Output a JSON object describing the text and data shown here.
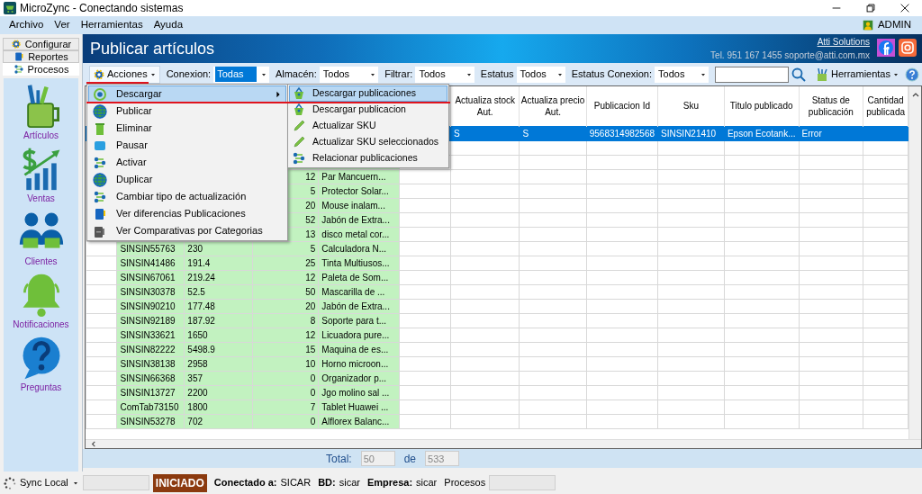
{
  "window": {
    "title": "MicroZync - Conectando sistemas"
  },
  "menu_bar": {
    "items": [
      "Archivo",
      "Ver",
      "Herramientas",
      "Ayuda"
    ],
    "user": "ADMIN"
  },
  "sidebar": {
    "tabs": [
      {
        "label": "Configurar",
        "selected": false
      },
      {
        "label": "Reportes",
        "selected": false
      },
      {
        "label": "Procesos",
        "selected": true
      }
    ],
    "items": [
      {
        "label": "Artículos"
      },
      {
        "label": "Ventas"
      },
      {
        "label": "Clientes"
      },
      {
        "label": "Notificaciones"
      },
      {
        "label": "Preguntas"
      }
    ]
  },
  "header": {
    "title": "Publicar artículos",
    "company": "Atti Solutions",
    "contact": "Tel. 951 167 1455  soporte@atti.com.mx"
  },
  "toolbar": {
    "actions": "Acciones",
    "filters": [
      {
        "label": "Conexion:",
        "value": "Todas",
        "text_selected": true
      },
      {
        "label": "Almacén:",
        "value": "Todos",
        "text_selected": false
      },
      {
        "label": "Filtrar:",
        "value": "Todos",
        "text_selected": false
      },
      {
        "label": "Estatus",
        "value": "Todos",
        "text_selected": false
      },
      {
        "label": "Estatus Conexion:",
        "value": "Todos",
        "text_selected": false
      }
    ],
    "tools": "Herramientas"
  },
  "actions_menu": {
    "items": [
      {
        "label": "Descargar",
        "selected": true,
        "has_submenu": true
      },
      {
        "label": "Publicar",
        "selected": false,
        "has_submenu": false
      },
      {
        "label": "Eliminar",
        "selected": false,
        "has_submenu": false
      },
      {
        "label": "Pausar",
        "selected": false,
        "has_submenu": false
      },
      {
        "label": "Activar",
        "selected": false,
        "has_submenu": false
      },
      {
        "label": "Duplicar",
        "selected": false,
        "has_submenu": false
      },
      {
        "label": "Cambiar tipo de actualización",
        "selected": false,
        "has_submenu": false
      },
      {
        "label": "Ver diferencias Publicaciones",
        "selected": false,
        "has_submenu": false
      },
      {
        "label": "Ver Comparativas por Categorias",
        "selected": false,
        "has_submenu": false
      }
    ]
  },
  "submenu": {
    "items": [
      {
        "label": "Descargar publicaciones",
        "selected": true
      },
      {
        "label": "Descargar publicacion",
        "selected": false
      },
      {
        "label": "Actualizar SKU",
        "selected": false
      },
      {
        "label": "Actualizar SKU seleccionados",
        "selected": false
      },
      {
        "label": "Relacionar publicaciones",
        "selected": false
      }
    ]
  },
  "table": {
    "columns": [
      "Actualiza stock Aut.",
      "Actualiza precio Aut.",
      "Publicacion Id",
      "Sku",
      "Titulo publicado",
      "Status de publicación",
      "Cantidad publicada"
    ],
    "rows": [
      {
        "selected": true,
        "actualiza_stock": "S",
        "actualiza_precio": "S",
        "publicacion_id": "9568314982568",
        "sku": "SINSIN21410",
        "titulo_publicado": "Epson Ecotank...",
        "status": "Error"
      },
      {
        "selected": false
      },
      {
        "selected": false
      },
      {
        "selected": false,
        "column_3": "12",
        "column_4": "Par Mancuern..."
      },
      {
        "selected": false,
        "column_3": "5",
        "column_4": "Protector Solar..."
      },
      {
        "selected": false,
        "column_3": "20",
        "column_4": "Mouse inalam..."
      },
      {
        "selected": false,
        "column_3": "52",
        "column_4": "Jabón de Extra..."
      },
      {
        "selected": false,
        "column_3": "13",
        "column_4": "disco metal cor..."
      },
      {
        "selected": false,
        "column_1": "SINSIN55763",
        "column_2": "230",
        "column_3": "5",
        "column_4": "Calculadora N..."
      },
      {
        "selected": false,
        "column_1": "SINSIN41486",
        "column_2": "191.4",
        "column_3": "25",
        "column_4": "Tinta Multiusos..."
      },
      {
        "selected": false,
        "column_1": "SINSIN67061",
        "column_2": "219.24",
        "column_3": "12",
        "column_4": "Paleta de Som..."
      },
      {
        "selected": false,
        "column_1": "SINSIN30378",
        "column_2": "52.5",
        "column_3": "50",
        "column_4": "Mascarilla de ..."
      },
      {
        "selected": false,
        "column_1": "SINSIN90210",
        "column_2": "177.48",
        "column_3": "20",
        "column_4": "Jabón de Extra..."
      },
      {
        "selected": false,
        "column_1": "SINSIN92189",
        "column_2": "187.92",
        "column_3": "8",
        "column_4": "Soporte para t..."
      },
      {
        "selected": false,
        "column_1": "SINSIN33621",
        "column_2": "1650",
        "column_3": "12",
        "column_4": "Licuadora pure..."
      },
      {
        "selected": false,
        "column_1": "SINSIN82222",
        "column_2": "5498.9",
        "column_3": "15",
        "column_4": "Maquina de es..."
      },
      {
        "selected": false,
        "column_1": "SINSIN38138",
        "column_2": "2958",
        "column_3": "10",
        "column_4": "Horno microon..."
      },
      {
        "selected": false,
        "column_1": "SINSIN66368",
        "column_2": "357",
        "column_3": "0",
        "column_4": "Organizador p..."
      },
      {
        "selected": false,
        "column_1": "SINSIN13727",
        "column_2": "2200",
        "column_3": "0",
        "column_4": "Jgo molino sal ..."
      },
      {
        "selected": false,
        "column_1": "ComTab73150",
        "column_2": "1800",
        "column_3": "7",
        "column_4": "Tablet Huawei ..."
      },
      {
        "selected": false,
        "column_1": "SINSIN53278",
        "column_2": "702",
        "column_3": "0",
        "column_4": "Alflorex Balanc..."
      }
    ]
  },
  "footer": {
    "total_label": "Total:",
    "shown": "50",
    "of_label": "de",
    "total": "533"
  },
  "status_bar": {
    "sync": "Sync Local",
    "state": "INICIADO",
    "fields": [
      {
        "label": "Conectado a:",
        "value": "SICAR"
      },
      {
        "label": "BD:",
        "value": "sicar"
      },
      {
        "label": "Empresa:",
        "value": "sicar"
      }
    ],
    "processes": "Procesos"
  }
}
